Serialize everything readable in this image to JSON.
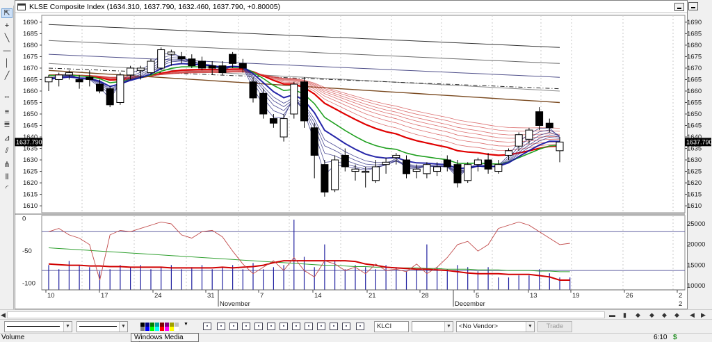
{
  "window": {
    "title": "KLSE Composite Index (1634.310, 1637.790, 1632.460, 1637.790, +0.80005)"
  },
  "left_toolbar": {
    "tools": [
      "pointer-tool-icon",
      "crosshair-tool-icon",
      "trendline-tool-icon",
      "horizontal-line-tool-icon",
      "vertical-line-tool-icon",
      "ray-tool-icon",
      "zoom-tool-icon",
      "channel-tool-icon",
      "fibonacci-retracement-icon",
      "fibonacci-fan-icon",
      "gann-tool-icon",
      "andrews-pitchfork-icon",
      "cycle-lines-icon",
      "arc-tool-icon"
    ]
  },
  "main_axis": {
    "ticks": [
      "1690",
      "1685",
      "1680",
      "1675",
      "1670",
      "1665",
      "1660",
      "1655",
      "1650",
      "1645",
      "1640",
      "1635",
      "1630",
      "1625",
      "1620",
      "1615",
      "1610"
    ],
    "last_price_label": "1637.790"
  },
  "lower_axis": {
    "left_ticks": [
      "0",
      "-50",
      "-100"
    ],
    "right_ticks": [
      "25000",
      "20000",
      "15000",
      "10000"
    ]
  },
  "time_axis": {
    "labels": [
      "10",
      "17",
      "24",
      "31",
      "7",
      "14",
      "21",
      "28",
      "5",
      "13",
      "19",
      "26",
      "2"
    ],
    "months": [
      "November",
      "December"
    ],
    "right_small": "2"
  },
  "colors": {
    "candle_fill_down": "#000000",
    "candle_fill_up": "#ffffff",
    "ema_red": "#e00000",
    "ema_blue": "#1010a0",
    "ema_green": "#20a020",
    "volume_bar": "#2020a0",
    "oscillator_line": "#c04040",
    "selected_tool_bg": "#cce0f8"
  },
  "chart_data": {
    "type": "candlestick",
    "title": "",
    "price_range": [
      1607,
      1693
    ],
    "candles": [
      {
        "o": 1664,
        "h": 1667,
        "l": 1660,
        "c": 1666
      },
      {
        "o": 1665,
        "h": 1668,
        "l": 1662,
        "c": 1667
      },
      {
        "o": 1667,
        "h": 1669,
        "l": 1665,
        "c": 1668
      },
      {
        "o": 1665,
        "h": 1667,
        "l": 1661,
        "c": 1664
      },
      {
        "o": 1666,
        "h": 1669,
        "l": 1662,
        "c": 1665
      },
      {
        "o": 1663,
        "h": 1665,
        "l": 1659,
        "c": 1660
      },
      {
        "o": 1661,
        "h": 1662,
        "l": 1653,
        "c": 1654
      },
      {
        "o": 1655,
        "h": 1668,
        "l": 1654,
        "c": 1667
      },
      {
        "o": 1667,
        "h": 1671,
        "l": 1665,
        "c": 1670
      },
      {
        "o": 1669,
        "h": 1671,
        "l": 1665,
        "c": 1670
      },
      {
        "o": 1668,
        "h": 1674,
        "l": 1667,
        "c": 1673
      },
      {
        "o": 1670,
        "h": 1679,
        "l": 1669,
        "c": 1678
      },
      {
        "o": 1676,
        "h": 1678,
        "l": 1671,
        "c": 1677
      },
      {
        "o": 1675,
        "h": 1677,
        "l": 1672,
        "c": 1674
      },
      {
        "o": 1674,
        "h": 1676,
        "l": 1670,
        "c": 1671
      },
      {
        "o": 1673,
        "h": 1675,
        "l": 1669,
        "c": 1670
      },
      {
        "o": 1671,
        "h": 1673,
        "l": 1667,
        "c": 1670
      },
      {
        "o": 1671,
        "h": 1673,
        "l": 1667,
        "c": 1668
      },
      {
        "o": 1676,
        "h": 1677,
        "l": 1670,
        "c": 1672
      },
      {
        "o": 1672,
        "h": 1674,
        "l": 1668,
        "c": 1670
      },
      {
        "o": 1664,
        "h": 1666,
        "l": 1655,
        "c": 1657
      },
      {
        "o": 1659,
        "h": 1661,
        "l": 1648,
        "c": 1650
      },
      {
        "o": 1648,
        "h": 1650,
        "l": 1644,
        "c": 1646
      },
      {
        "o": 1640,
        "h": 1650,
        "l": 1638,
        "c": 1648
      },
      {
        "o": 1650,
        "h": 1664,
        "l": 1648,
        "c": 1663
      },
      {
        "o": 1664,
        "h": 1666,
        "l": 1644,
        "c": 1647
      },
      {
        "o": 1644,
        "h": 1646,
        "l": 1622,
        "c": 1632
      },
      {
        "o": 1628,
        "h": 1630,
        "l": 1614,
        "c": 1616
      },
      {
        "o": 1617,
        "h": 1632,
        "l": 1616,
        "c": 1630
      },
      {
        "o": 1632,
        "h": 1635,
        "l": 1625,
        "c": 1627
      },
      {
        "o": 1625,
        "h": 1628,
        "l": 1621,
        "c": 1626
      },
      {
        "o": 1625,
        "h": 1627,
        "l": 1618,
        "c": 1625
      },
      {
        "o": 1621,
        "h": 1630,
        "l": 1620,
        "c": 1627
      },
      {
        "o": 1628,
        "h": 1631,
        "l": 1624,
        "c": 1629
      },
      {
        "o": 1631,
        "h": 1633,
        "l": 1628,
        "c": 1632
      },
      {
        "o": 1630,
        "h": 1632,
        "l": 1622,
        "c": 1624
      },
      {
        "o": 1625,
        "h": 1628,
        "l": 1622,
        "c": 1626
      },
      {
        "o": 1624,
        "h": 1629,
        "l": 1622,
        "c": 1628
      },
      {
        "o": 1625,
        "h": 1629,
        "l": 1623,
        "c": 1627
      },
      {
        "o": 1630,
        "h": 1632,
        "l": 1625,
        "c": 1627
      },
      {
        "o": 1628,
        "h": 1630,
        "l": 1618,
        "c": 1620
      },
      {
        "o": 1621,
        "h": 1629,
        "l": 1620,
        "c": 1628
      },
      {
        "o": 1628,
        "h": 1631,
        "l": 1625,
        "c": 1630
      },
      {
        "o": 1630,
        "h": 1633,
        "l": 1624,
        "c": 1626
      },
      {
        "o": 1625,
        "h": 1630,
        "l": 1624,
        "c": 1628
      },
      {
        "o": 1632,
        "h": 1635,
        "l": 1630,
        "c": 1634
      },
      {
        "o": 1636,
        "h": 1642,
        "l": 1634,
        "c": 1641
      },
      {
        "o": 1639,
        "h": 1644,
        "l": 1637,
        "c": 1643
      },
      {
        "o": 1651,
        "h": 1653,
        "l": 1643,
        "c": 1645
      },
      {
        "o": 1646,
        "h": 1648,
        "l": 1642,
        "c": 1644
      },
      {
        "o": 1634,
        "h": 1640,
        "l": 1629,
        "c": 1637.79
      }
    ],
    "oscillator": {
      "range": [
        -110,
        5
      ],
      "osc_line": [
        -20,
        -15,
        -25,
        -30,
        -40,
        -95,
        -25,
        -18,
        -20,
        -15,
        -10,
        -5,
        -8,
        -25,
        -30,
        -20,
        -18,
        -28,
        -50,
        -70,
        -85,
        -75,
        -65,
        -80,
        -60,
        -80,
        -90,
        -65,
        -70,
        -80,
        -75,
        -85,
        -70,
        -80,
        -78,
        -82,
        -70,
        -85,
        -75,
        -60,
        -40,
        -35,
        -50,
        -40,
        -15,
        -10,
        -5,
        -10,
        -20,
        -30,
        -40,
        -38
      ],
      "signal_line": [
        -70,
        -71,
        -72,
        -72,
        -73,
        -73,
        -74,
        -74,
        -75,
        -75,
        -75,
        -75,
        -76,
        -76,
        -76,
        -76,
        -76,
        -75,
        -76,
        -75,
        -74,
        -72,
        -68,
        -65,
        -65,
        -65,
        -65,
        -65,
        -65,
        -65,
        -66,
        -70,
        -72,
        -75,
        -76,
        -77,
        -78,
        -78,
        -79,
        -80,
        -82,
        -84,
        -85,
        -85,
        -85,
        -86,
        -86,
        -86,
        -88,
        -90,
        -95,
        -95
      ],
      "slow_line": [
        -45,
        -46,
        -47,
        -48,
        -49,
        -50,
        -51,
        -52,
        -53,
        -54,
        -55,
        -56,
        -57,
        -58,
        -59,
        -60,
        -61,
        -62,
        -63,
        -64,
        -65,
        -66,
        -67,
        -68,
        -69,
        -70,
        -71,
        -72,
        -72,
        -73,
        -74,
        -74,
        -75,
        -75,
        -76,
        -76,
        -76,
        -77,
        -77,
        -78,
        -78,
        -78,
        -79,
        -79,
        -79,
        -80,
        -80,
        -80,
        -81,
        -81,
        -82,
        -82
      ],
      "levels": [
        -20,
        -80
      ]
    },
    "volume": {
      "range": [
        9000,
        27000
      ],
      "values": [
        15000,
        14000,
        16000,
        15000,
        14500,
        13500,
        14000,
        15000,
        14500,
        15000,
        14000,
        14500,
        15000,
        14000,
        14500,
        15000,
        14000,
        14500,
        15000,
        14000,
        15500,
        14000,
        14500,
        15000,
        26000,
        17000,
        14500,
        20000,
        16000,
        14000,
        15000,
        14500,
        14000,
        15000,
        14500,
        13500,
        14000,
        20000,
        14500,
        14000,
        15000,
        14500,
        13500,
        14500,
        12000,
        12000,
        12500,
        12500,
        14000,
        13000,
        12000,
        12000
      ]
    }
  }
}
